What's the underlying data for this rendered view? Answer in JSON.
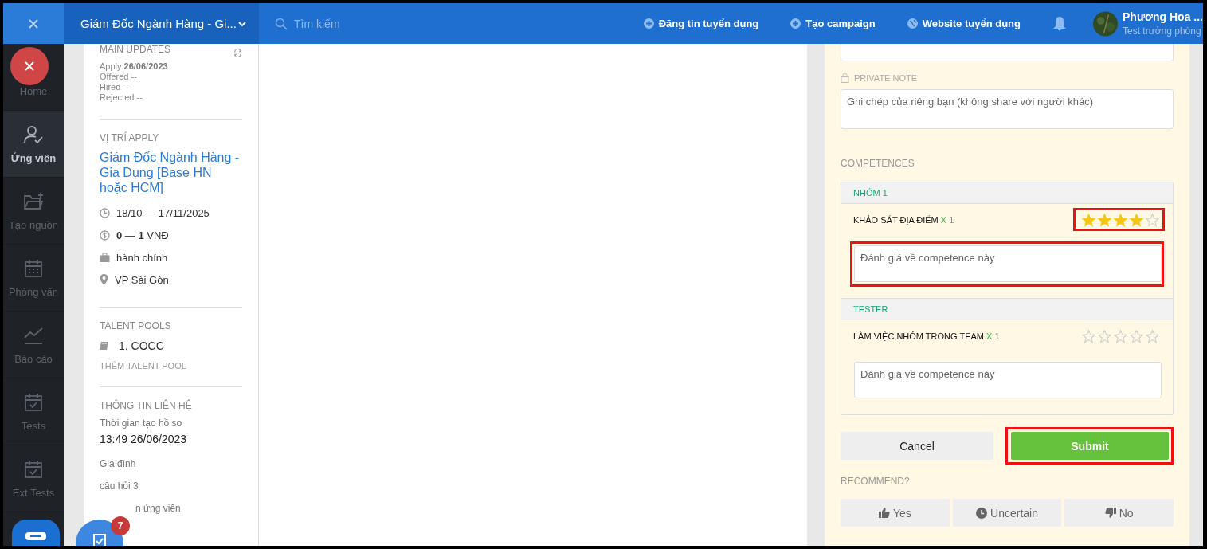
{
  "topbar": {
    "job_title": "Giám Đốc Ngành Hàng - Gi...",
    "search_placeholder": "Tìm kiếm",
    "actions": [
      {
        "kind": "plus",
        "label": "Đăng tin tuyển dụng"
      },
      {
        "kind": "plus",
        "label": "Tạo campaign"
      },
      {
        "kind": "globe",
        "label": "Website tuyển dụng"
      }
    ],
    "user": {
      "name": "Phương Hoa ...",
      "role": "Test trưởng phòng"
    }
  },
  "nav": [
    {
      "kind": "home",
      "label": "Home",
      "selected": false
    },
    {
      "kind": "user",
      "label": "Ứng viên",
      "selected": true
    },
    {
      "kind": "folder",
      "label": "Tạo nguồn",
      "selected": false
    },
    {
      "kind": "calendar",
      "label": "Phỏng vấn",
      "selected": false
    },
    {
      "kind": "chart",
      "label": "Báo cáo",
      "selected": false
    },
    {
      "kind": "test",
      "label": "Tests",
      "selected": false
    },
    {
      "kind": "test",
      "label": "Ext Tests",
      "selected": false
    }
  ],
  "profile": {
    "main_updates": {
      "title": "MAIN UPDATES",
      "lines": [
        "Apply **26/06/2023**",
        "Offered --",
        "Hired --",
        "Rejected --"
      ]
    },
    "position": {
      "heading": "VỊ TRÍ APPLY",
      "title": "Giám Đốc Ngành Hàng - Gia Dụng [Base HN hoặc HCM]",
      "details": [
        {
          "kind": "clock",
          "text": "18/10 — 17/11/2025"
        },
        {
          "kind": "money",
          "text": "**0** — **1** VNĐ"
        },
        {
          "kind": "briefcase",
          "text": "hành chính"
        },
        {
          "kind": "pin",
          "text": "VP Sài Gòn"
        }
      ]
    },
    "talent_pools": {
      "heading": "TALENT POOLS",
      "items": [
        "1. COCC"
      ],
      "add": "THÊM TALENT POOL"
    },
    "contact": {
      "heading": "THÔNG TIN LIÊN HỆ",
      "fields": [
        {
          "label": "Thời gian tạo hồ sơ",
          "value": "13:49 26/06/2023"
        },
        {
          "label": "Gia đình"
        },
        {
          "label": "câu hỏi 3"
        }
      ],
      "partial": "n ứng viên"
    },
    "badge": "7"
  },
  "review": {
    "private_note": {
      "label": "PRIVATE NOTE",
      "placeholder": "Ghi chép của riêng bạn (không share với người khác)"
    },
    "competences_heading": "COMPETENCES",
    "groups": [
      {
        "name": "NHÓM 1",
        "items": [
          {
            "name": "KHẢO SÁT ĐỊA ĐIỂM",
            "x": "X",
            "weight": "1",
            "stars": 4,
            "placeholder": "Đánh giá về competence này",
            "stars_highlighted": true,
            "comment_highlighted": true
          }
        ]
      },
      {
        "name": "TESTER",
        "items": [
          {
            "name": "LÀM VIỆC NHÓM TRONG TEAM",
            "x": "X",
            "weight": "1",
            "stars": 0,
            "placeholder": "Đánh giá về competence này",
            "stars_highlighted": false,
            "comment_highlighted": false
          }
        ]
      }
    ],
    "cancel": "Cancel",
    "submit": {
      "label": "Submit",
      "highlighted": true
    },
    "recommend_heading": "RECOMMEND?",
    "recommend": [
      {
        "kind": "yes",
        "label": "Yes"
      },
      {
        "kind": "uncertain",
        "label": "Uncertain"
      },
      {
        "kind": "no",
        "label": "No"
      }
    ]
  }
}
